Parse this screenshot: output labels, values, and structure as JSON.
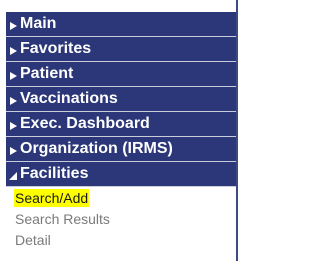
{
  "menu": {
    "items": [
      {
        "label": "Main",
        "state": "collapsed"
      },
      {
        "label": "Favorites",
        "state": "collapsed"
      },
      {
        "label": "Patient",
        "state": "collapsed"
      },
      {
        "label": "Vaccinations",
        "state": "collapsed"
      },
      {
        "label": "Exec. Dashboard",
        "state": "collapsed"
      },
      {
        "label": "Organization (IRMS)",
        "state": "collapsed"
      },
      {
        "label": "Facilities",
        "state": "expanded"
      }
    ],
    "facilities_subitems": [
      {
        "label": "Search/Add",
        "active": true
      },
      {
        "label": "Search Results",
        "active": false
      },
      {
        "label": "Detail",
        "active": false
      }
    ]
  },
  "colors": {
    "header_bg": "#2b3778",
    "header_text": "#ffffff",
    "highlight": "#ffff00",
    "subitem_text": "#7a7a7a"
  },
  "icons": {
    "collapsed": "triangle-right-icon",
    "expanded": "triangle-down-icon"
  }
}
